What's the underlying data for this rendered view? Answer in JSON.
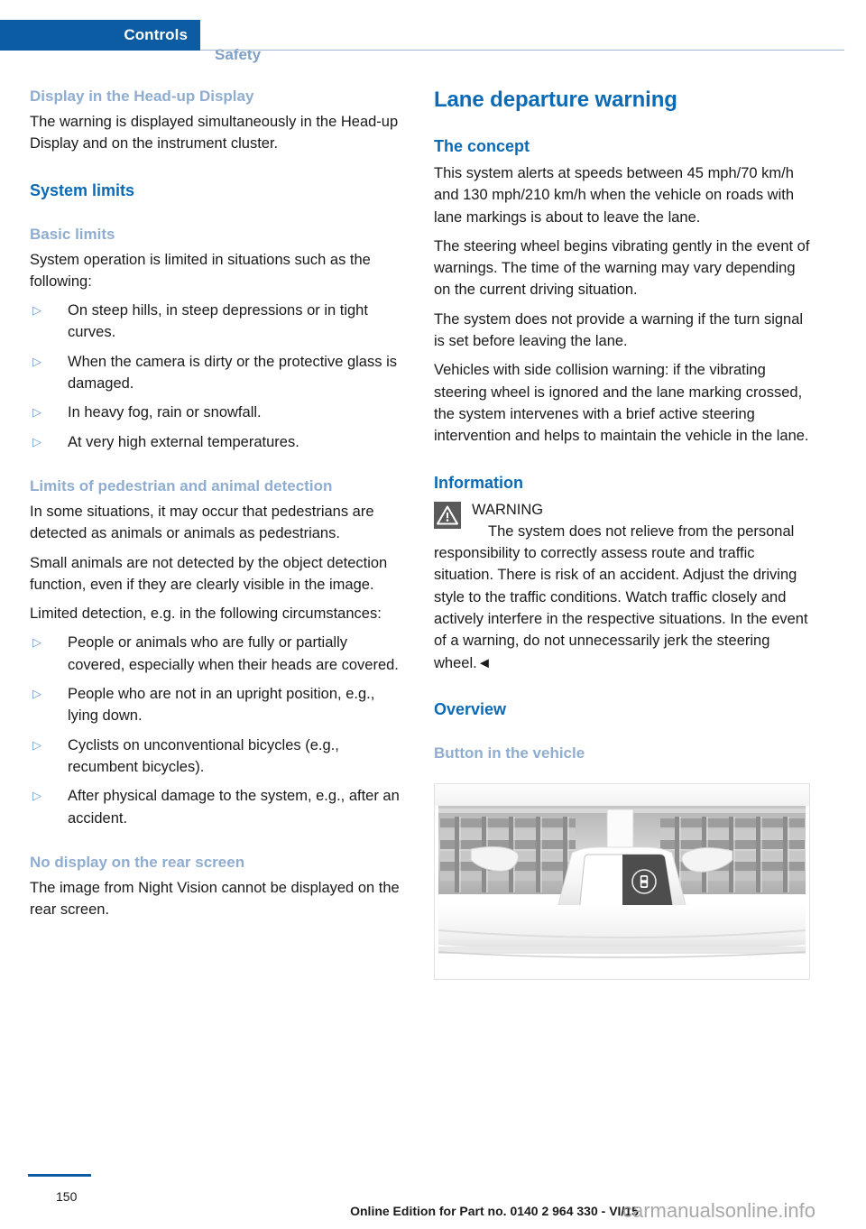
{
  "header": {
    "active_tab": "Controls",
    "inactive_tab": "Safety"
  },
  "left_column": {
    "heading_headup": "Display in the Head-up Display",
    "para_headup": "The warning is displayed simultaneously in the Head-up Display and on the instrument cluster.",
    "heading_system_limits": "System limits",
    "heading_basic_limits": "Basic limits",
    "para_basic_intro": "System operation is limited in situations such as the following:",
    "basic_bullets": [
      "On steep hills, in steep depressions or in tight curves.",
      "When the camera is dirty or the protective glass is damaged.",
      "In heavy fog, rain or snowfall.",
      "At very high external temperatures."
    ],
    "heading_limits_detection": "Limits of pedestrian and animal detection",
    "para_detection_1": "In some situations, it may occur that pedestrians are detected as animals or animals as pedestrians.",
    "para_detection_2": "Small animals are not detected by the object detection function, even if they are clearly visible in the image.",
    "para_detection_3": "Limited detection, e.g. in the following circumstances:",
    "detection_bullets": [
      "People or animals who are fully or partially covered, especially when their heads are covered.",
      "People who are not in an upright position, e.g., lying down.",
      "Cyclists on unconventional bicycles (e.g., recumbent bicycles).",
      "After physical damage to the system, e.g., after an accident."
    ],
    "heading_no_display": "No display on the rear screen",
    "para_no_display": "The image from Night Vision cannot be displayed on the rear screen."
  },
  "right_column": {
    "title": "Lane departure warning",
    "heading_concept": "The concept",
    "para_concept_1": "This system alerts at speeds between 45 mph/70 km/h and 130 mph/210 km/h when the vehicle on roads with lane markings is about to leave the lane.",
    "para_concept_2": "The steering wheel begins vibrating gently in the event of warnings. The time of the warning may vary depending on the current driving situation.",
    "para_concept_3": "The system does not provide a warning if the turn signal is set before leaving the lane.",
    "para_concept_4": "Vehicles with side collision warning: if the vibrating steering wheel is ignored and the lane marking crossed, the system intervenes with a brief active steering intervention and helps to maintain the vehicle in the lane.",
    "heading_information": "Information",
    "warning_label": "WARNING",
    "warning_text": "The system does not relieve from the personal responsibility to correctly assess route and traffic situation. There is risk of an accident. Adjust the driving style to the traffic conditions. Watch traffic closely and actively interfere in the respective situations. In the event of a warning, do not unnecessarily jerk the steering wheel.◄",
    "heading_overview": "Overview",
    "heading_button": "Button in the vehicle",
    "figure_alt": "Vehicle dashboard center console with air vents and lane departure warning button"
  },
  "footer": {
    "page_number": "150",
    "edition": "Online Edition for Part no. 0140 2 964 330 - VI/15",
    "watermark": "carmanualsonline.info"
  },
  "colors": {
    "tab_active_bg": "#0b5ca3",
    "heading_primary": "#0b6ab5",
    "heading_secondary": "#8fadd0",
    "bullet_marker": "#6b9bd0",
    "warning_icon_bg": "#5a5a5a",
    "body_text": "#1a1a1a"
  }
}
